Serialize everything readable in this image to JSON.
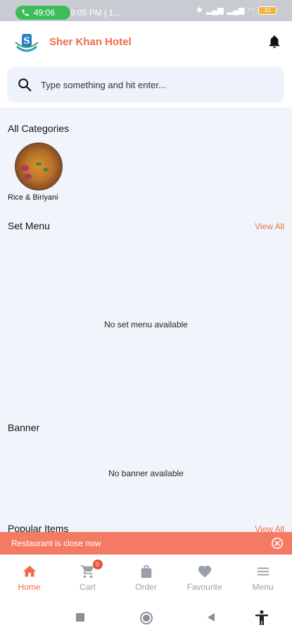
{
  "status_bar": {
    "call_timer": "49:06",
    "time": "9:05 PM | 1...",
    "battery": "31"
  },
  "header": {
    "title": "Sher Khan Hotel",
    "logo_letter": "S",
    "bell_icon": "bell-icon"
  },
  "search": {
    "placeholder": "Type something and hit enter...",
    "value": ""
  },
  "categories": {
    "title": "All Categories",
    "items": [
      {
        "label": "Rice & Biriyani",
        "icon": "biriyani-image"
      }
    ]
  },
  "set_menu": {
    "title": "Set Menu",
    "view_all": "View All",
    "empty": "No set menu available"
  },
  "banner": {
    "title": "Banner",
    "empty": "No banner available"
  },
  "popular": {
    "title": "Popular Items",
    "view_all": "View All"
  },
  "notice": {
    "text": "Restaurant is close now"
  },
  "bottom_nav": {
    "items": [
      {
        "label": "Home",
        "icon": "home-icon",
        "active": true
      },
      {
        "label": "Cart",
        "icon": "cart-icon",
        "badge": "0"
      },
      {
        "label": "Order",
        "icon": "bag-icon"
      },
      {
        "label": "Favourite",
        "icon": "heart-icon"
      },
      {
        "label": "Menu",
        "icon": "menu-icon"
      }
    ]
  },
  "colors": {
    "accent": "#f06a4a",
    "notice_bg": "#f57a63",
    "content_bg": "#f1f5fb"
  }
}
